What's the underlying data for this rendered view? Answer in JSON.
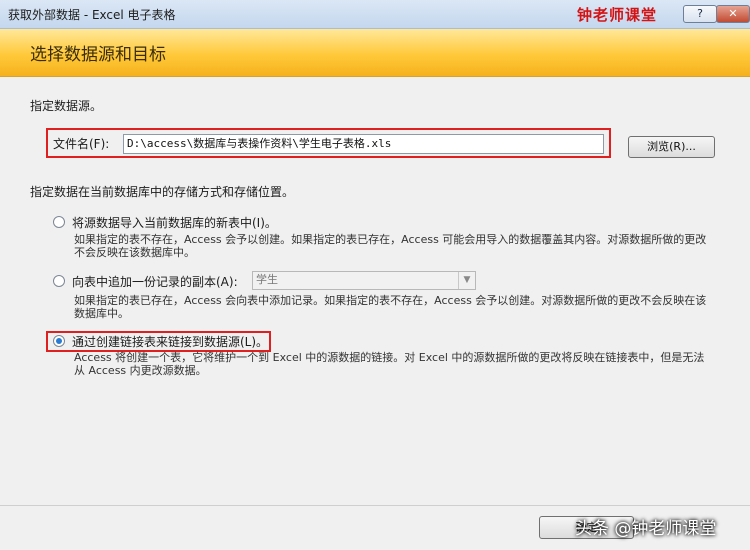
{
  "window": {
    "title": "获取外部数据 - Excel 电子表格",
    "help_label": "?",
    "close_label": "✕"
  },
  "watermark": {
    "top_text": "钟老师课堂",
    "bottom_text": "头条 @钟老师课堂"
  },
  "header": {
    "title": "选择数据源和目标"
  },
  "source": {
    "heading": "指定数据源。",
    "file_label": "文件名(F):",
    "file_value": "D:\\access\\数据库与表操作资料\\学生电子表格.xls",
    "browse_label": "浏览(R)..."
  },
  "storage": {
    "heading": "指定数据在当前数据库中的存储方式和存储位置。",
    "options": [
      {
        "label": "将源数据导入当前数据库的新表中(I)。",
        "description": "如果指定的表不存在，Access 会予以创建。如果指定的表已存在，Access 可能会用导入的数据覆盖其内容。对源数据所做的更改不会反映在该数据库中。",
        "checked": false
      },
      {
        "label": "向表中追加一份记录的副本(A):",
        "description": "如果指定的表已存在，Access 会向表中添加记录。如果指定的表不存在，Access 会予以创建。对源数据所做的更改不会反映在该数据库中。",
        "checked": false,
        "combo_value": "学生"
      },
      {
        "label": "通过创建链接表来链接到数据源(L)。",
        "description": "Access 将创建一个表，它将维护一个到 Excel 中的源数据的链接。对 Excel 中的源数据所做的更改将反映在链接表中，但是无法从 Access 内更改源数据。",
        "checked": true
      }
    ]
  },
  "footer": {
    "ok_label": "确定"
  }
}
